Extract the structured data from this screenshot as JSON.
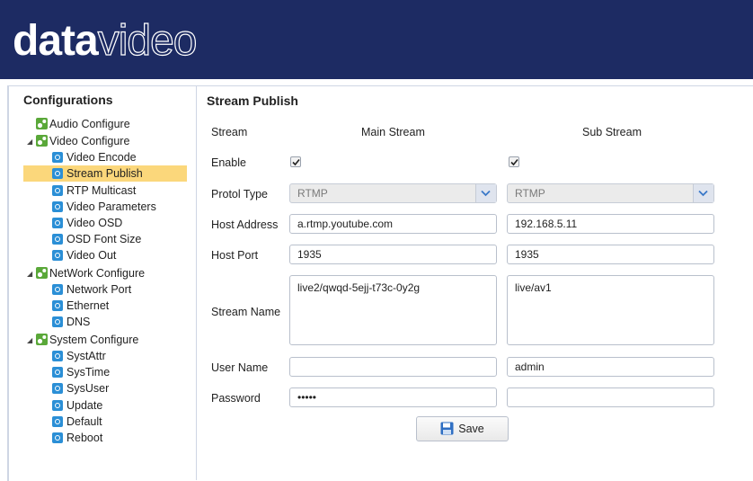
{
  "logo": {
    "bold": "data",
    "light": "video"
  },
  "sidebar": {
    "title": "Configurations",
    "groups": {
      "audio": "Audio Configure",
      "video": "Video Configure",
      "network": "NetWork Configure",
      "system": "System Configure"
    },
    "video_items": [
      "Video Encode",
      "Stream Publish",
      "RTP Multicast",
      "Video Parameters",
      "Video OSD",
      "OSD Font Size",
      "Video Out"
    ],
    "network_items": [
      "Network Port",
      "Ethernet",
      "DNS"
    ],
    "system_items": [
      "SystAttr",
      "SysTime",
      "SysUser",
      "Update",
      "Default",
      "Reboot"
    ],
    "selected": "Stream Publish",
    "selected_color": "#fbd77b"
  },
  "panel": {
    "title": "Stream Publish",
    "labels": {
      "stream": "Stream",
      "enable": "Enable",
      "protocol": "Protol Type",
      "host_address": "Host Address",
      "host_port": "Host Port",
      "stream_name": "Stream Name",
      "user_name": "User Name",
      "password": "Password"
    },
    "main": {
      "header": "Main Stream",
      "enabled": true,
      "protocol": "RTMP",
      "host_address": "a.rtmp.youtube.com",
      "host_port": "1935",
      "stream_name": "live2/qwqd-5ejj-t73c-0y2g",
      "user_name": "",
      "password": "•••••"
    },
    "sub": {
      "header": "Sub Stream",
      "enabled": true,
      "protocol": "RTMP",
      "host_address": "192.168.5.11",
      "host_port": "1935",
      "stream_name": "live/av1",
      "user_name": "admin",
      "password": ""
    },
    "save_label": "Save"
  },
  "colors": {
    "header_bg": "#1d2b63",
    "accent": "#2b8fd6"
  }
}
